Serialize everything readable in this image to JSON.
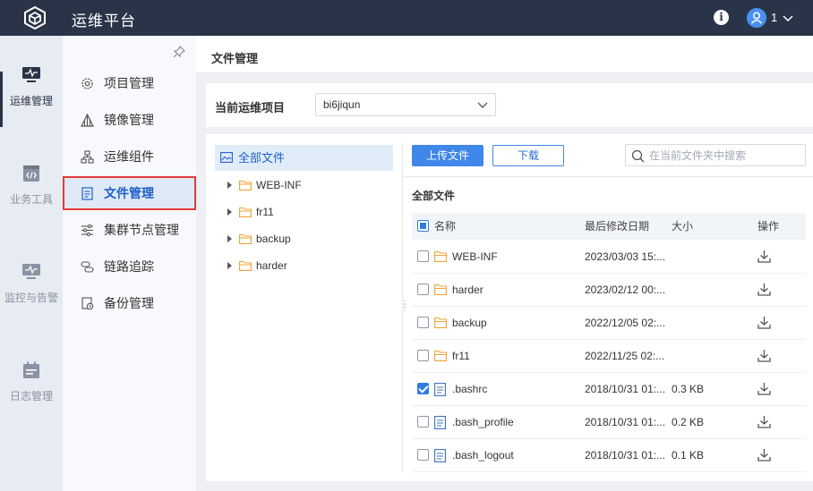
{
  "app": {
    "title": "运维平台",
    "user": "1"
  },
  "rail": [
    {
      "label": "运维管理",
      "icon": "monitor-pulse-icon",
      "active": true
    },
    {
      "label": "业务工具",
      "icon": "code-window-icon",
      "active": false
    },
    {
      "label": "监控与告警",
      "icon": "monitor-alert-icon",
      "active": false
    },
    {
      "label": "日志管理",
      "icon": "calendar-log-icon",
      "active": false
    }
  ],
  "menu": [
    {
      "label": "项目管理",
      "icon": "gear-icon"
    },
    {
      "label": "镜像管理",
      "icon": "triangle-mirror-icon"
    },
    {
      "label": "运维组件",
      "icon": "sitemap-icon"
    },
    {
      "label": "文件管理",
      "icon": "document-icon",
      "active": true
    },
    {
      "label": "集群节点管理",
      "icon": "sliders-icon"
    },
    {
      "label": "链路追踪",
      "icon": "link-trace-icon"
    },
    {
      "label": "备份管理",
      "icon": "backup-icon"
    }
  ],
  "page": {
    "title": "文件管理",
    "project_label": "当前运维项目",
    "project_value": "bi6jiqun"
  },
  "tree": {
    "root": "全部文件",
    "nodes": [
      "WEB-INF",
      "fr11",
      "backup",
      "harder"
    ]
  },
  "toolbar": {
    "upload": "上传文件",
    "download": "下载",
    "search_placeholder": "在当前文件夹中搜索"
  },
  "table": {
    "section_title": "全部文件",
    "headers": {
      "name": "名称",
      "modified": "最后修改日期",
      "size": "大小",
      "action": "操作"
    },
    "rows": [
      {
        "type": "folder",
        "name": "WEB-INF",
        "modified": "2023/03/03 15:...",
        "size": "",
        "checked": false
      },
      {
        "type": "folder",
        "name": "harder",
        "modified": "2023/02/12 00:...",
        "size": "",
        "checked": false
      },
      {
        "type": "folder",
        "name": "backup",
        "modified": "2022/12/05 02:...",
        "size": "",
        "checked": false
      },
      {
        "type": "folder",
        "name": "fr11",
        "modified": "2022/11/25 02:...",
        "size": "",
        "checked": false
      },
      {
        "type": "file",
        "name": ".bashrc",
        "modified": "2018/10/31 01:...",
        "size": "0.3 KB",
        "checked": true
      },
      {
        "type": "file",
        "name": ".bash_profile",
        "modified": "2018/10/31 01:...",
        "size": "0.2 KB",
        "checked": false
      },
      {
        "type": "file",
        "name": ".bash_logout",
        "modified": "2018/10/31 01:...",
        "size": "0.1 KB",
        "checked": false
      }
    ]
  }
}
